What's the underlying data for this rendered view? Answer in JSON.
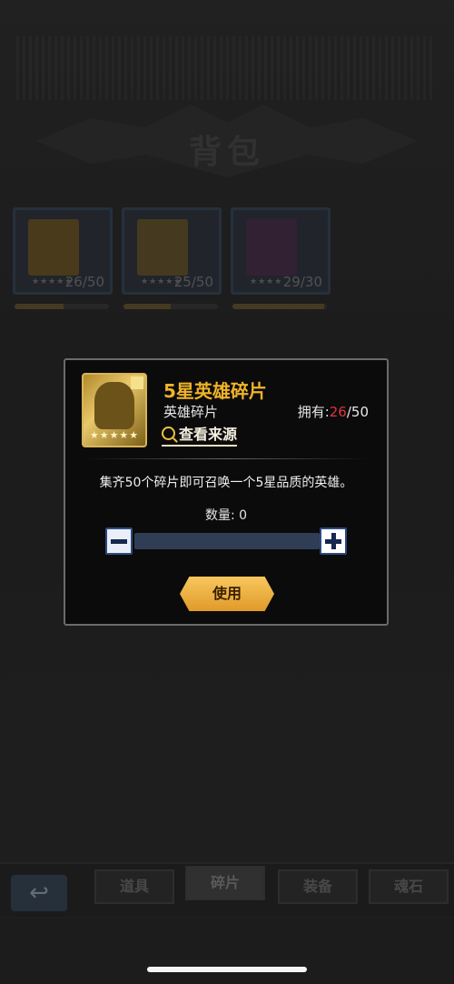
{
  "page": {
    "title": "背包"
  },
  "inventory": [
    {
      "count": "26/50",
      "stars": "★★★★★",
      "color": "#b38a2e",
      "fill": 0.52
    },
    {
      "count": "25/50",
      "stars": "★★★★★",
      "color": "#a88a3a",
      "fill": 0.5
    },
    {
      "count": "29/30",
      "stars": "★★★★",
      "color": "#6a3d6d",
      "fill": 0.97
    }
  ],
  "modal": {
    "item_name": "5星英雄碎片",
    "item_type": "英雄碎片",
    "own_label": "拥有:",
    "own_count": "26",
    "own_total": "/50",
    "stars": "★★★★★",
    "source_link": "查看来源",
    "description": "集齐50个碎片即可召唤一个5星品质的英雄。",
    "quantity_label": "数量: 0",
    "use_button": "使用",
    "accent_color": "#f0b329"
  },
  "tabs": [
    {
      "label": "道具"
    },
    {
      "label": "碎片"
    },
    {
      "label": "装备"
    },
    {
      "label": "魂石"
    }
  ],
  "back_icon": "return-arrow-icon"
}
